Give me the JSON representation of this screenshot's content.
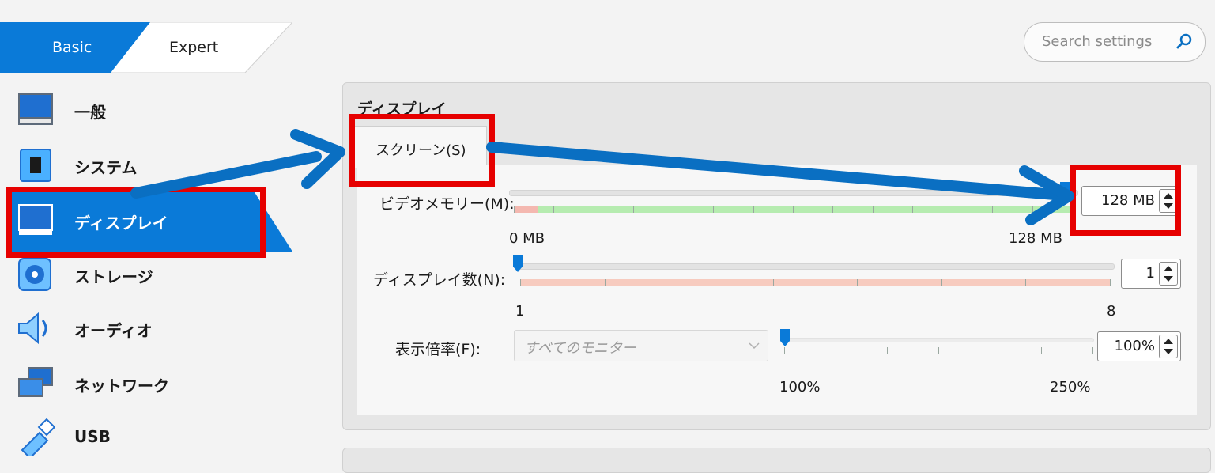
{
  "mode_tabs": {
    "basic": "Basic",
    "expert": "Expert"
  },
  "search": {
    "placeholder": "Search settings"
  },
  "sidebar": {
    "items": [
      {
        "label": "一般",
        "icon": "monitor-icon"
      },
      {
        "label": "システム",
        "icon": "chip-icon"
      },
      {
        "label": "ディスプレイ",
        "icon": "display-icon",
        "selected": true
      },
      {
        "label": "ストレージ",
        "icon": "disk-icon"
      },
      {
        "label": "オーディオ",
        "icon": "speaker-icon"
      },
      {
        "label": "ネットワーク",
        "icon": "network-icon"
      },
      {
        "label": "USB",
        "icon": "usb-icon"
      }
    ]
  },
  "panel": {
    "title": "ディスプレイ",
    "tab": "スクリーン(S)",
    "video_memory": {
      "label": "ビデオメモリー(M):",
      "min": "0 MB",
      "max": "128 MB",
      "value": "128 MB"
    },
    "monitor_count": {
      "label": "ディスプレイ数(N):",
      "min": "1",
      "max": "8",
      "value": "1"
    },
    "scale_factor": {
      "label": "表示倍率(F):",
      "combo": "すべてのモニター",
      "min": "100%",
      "max": "250%",
      "value": "100%"
    }
  },
  "colors": {
    "accent": "#0a7ad8",
    "highlight": "#e60000",
    "arrow": "#0a6fc2"
  }
}
